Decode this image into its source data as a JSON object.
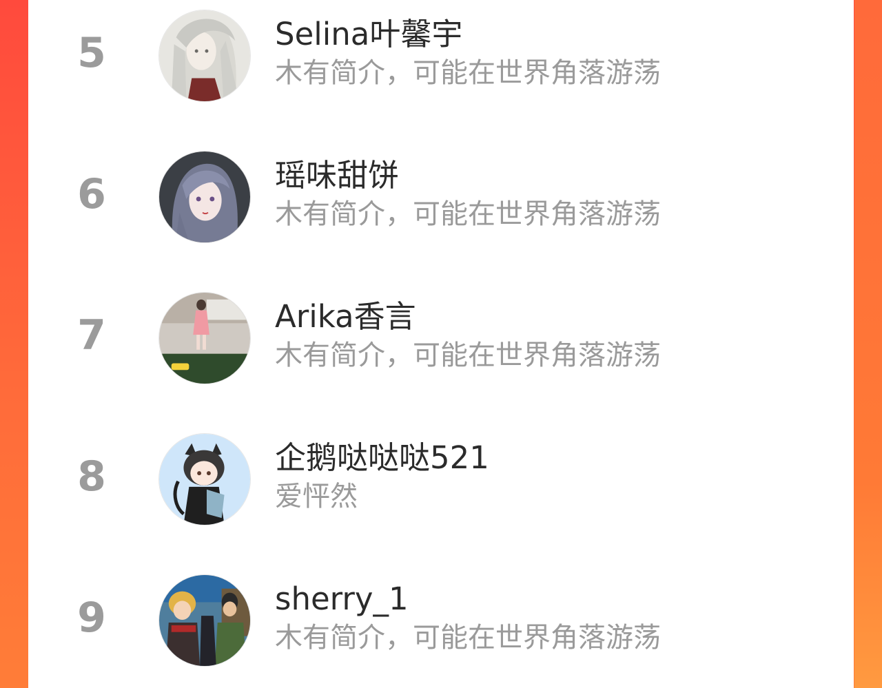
{
  "ranking": {
    "items": [
      {
        "rank": "5",
        "name": "Selina叶馨宇",
        "bio": "木有简介，可能在世界角落游荡",
        "avatar_icon": "anime-girl-white-hair-avatar-icon"
      },
      {
        "rank": "6",
        "name": "瑶味甜饼",
        "bio": "木有简介，可能在世界角落游荡",
        "avatar_icon": "anime-girl-dark-hair-avatar-icon"
      },
      {
        "rank": "7",
        "name": "Arika香言",
        "bio": "木有简介，可能在世界角落游荡",
        "avatar_icon": "photo-girl-pink-dress-avatar-icon"
      },
      {
        "rank": "8",
        "name": "企鹅哒哒哒521",
        "bio": "爱怦然",
        "avatar_icon": "cat-ear-girl-cartoon-avatar-icon"
      },
      {
        "rank": "9",
        "name": "sherry_1",
        "bio": "木有简介，可能在世界角落游荡",
        "avatar_icon": "anime-ninja-group-avatar-icon"
      }
    ]
  },
  "colors": {
    "background_gradient_top": "#ff4a3d",
    "background_gradient_bottom": "#ff7d38",
    "rank_color": "#9b9b9b",
    "name_color": "#2b2b2b",
    "bio_color": "#9a9a9a"
  }
}
